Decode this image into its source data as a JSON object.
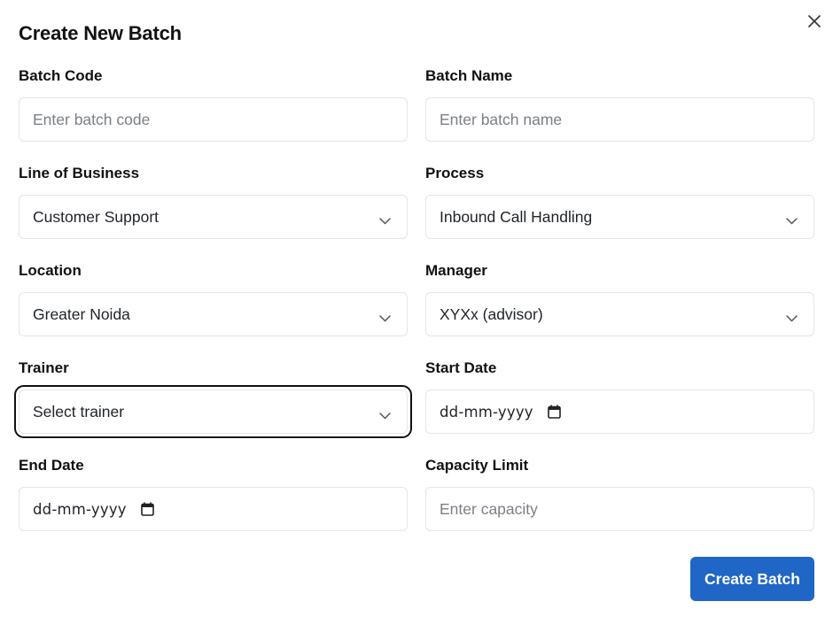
{
  "dialog": {
    "title": "Create New Batch",
    "close_icon": "close-icon"
  },
  "fields": {
    "batch_code": {
      "label": "Batch Code",
      "placeholder": "Enter batch code",
      "value": ""
    },
    "batch_name": {
      "label": "Batch Name",
      "placeholder": "Enter batch name",
      "value": ""
    },
    "line_of_business": {
      "label": "Line of Business",
      "selected": "Customer Support",
      "icon": "chevron-down-icon"
    },
    "process": {
      "label": "Process",
      "selected": "Inbound Call Handling",
      "icon": "chevron-down-icon"
    },
    "location": {
      "label": "Location",
      "selected": "Greater Noida",
      "icon": "chevron-down-icon"
    },
    "manager": {
      "label": "Manager",
      "selected": "XYXx (advisor)",
      "icon": "chevron-down-icon"
    },
    "trainer": {
      "label": "Trainer",
      "selected": "Select trainer",
      "icon": "chevron-down-icon"
    },
    "start_date": {
      "label": "Start Date",
      "value": "dd-mm-yyyy",
      "icon": "calendar-icon"
    },
    "end_date": {
      "label": "End Date",
      "value": "dd-mm-yyyy",
      "icon": "calendar-icon"
    },
    "capacity": {
      "label": "Capacity Limit",
      "placeholder": "Enter capacity",
      "value": ""
    }
  },
  "actions": {
    "submit_label": "Create Batch",
    "submit_color": "#1f66c6"
  }
}
